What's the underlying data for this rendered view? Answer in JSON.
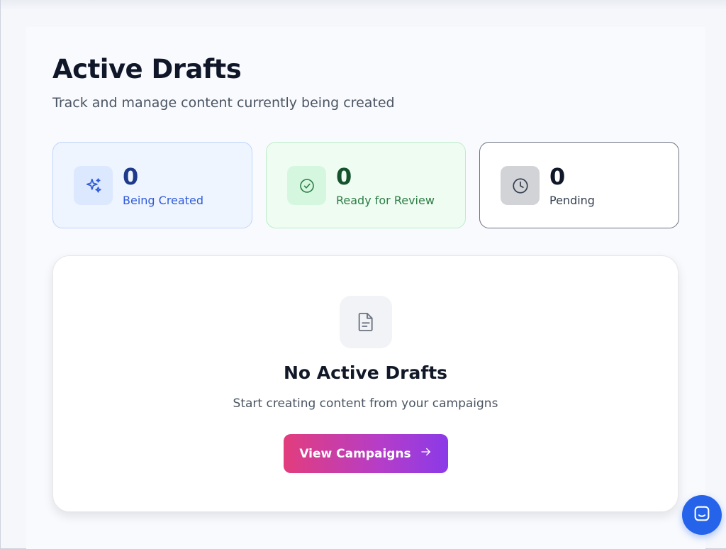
{
  "page": {
    "title": "Active Drafts",
    "subtitle": "Track and manage content currently being created"
  },
  "stats": [
    {
      "value": "0",
      "label": "Being Created",
      "icon": "sparkles-icon",
      "color": "#2f5bd9"
    },
    {
      "value": "0",
      "label": "Ready for Review",
      "icon": "check-circle-icon",
      "color": "#2e7d46"
    },
    {
      "value": "0",
      "label": "Pending",
      "icon": "clock-icon",
      "color": "#374151"
    }
  ],
  "empty_state": {
    "icon": "document-icon",
    "title": "No Active Drafts",
    "description": "Start creating content from your campaigns",
    "button_label": "View Campaigns",
    "button_icon": "arrow-right-icon"
  },
  "chat_widget": {
    "icon": "chat-icon",
    "color": "#2563eb"
  }
}
